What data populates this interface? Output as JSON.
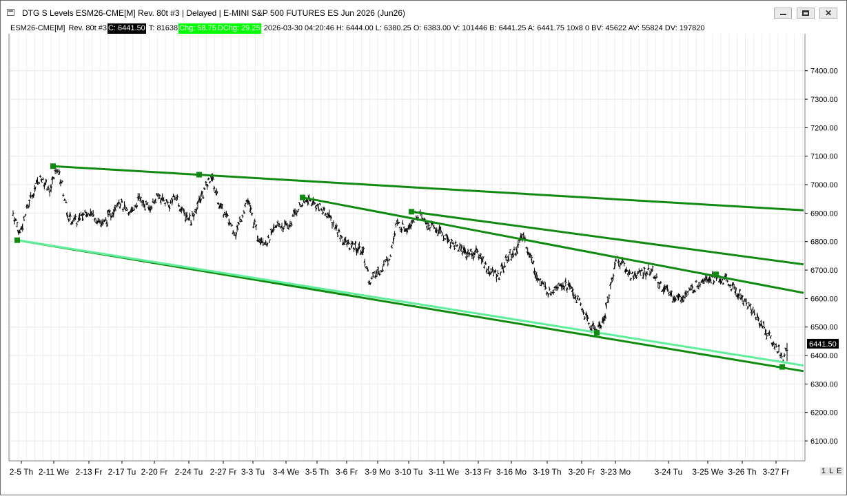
{
  "window": {
    "title": "DTG S Levels ESM26-CME[M]  Rev. 80t #3 | Delayed | E-MINI S&P 500 FUTURES ES Jun 2026 (Jun26)",
    "minimize_icon": "minimize-icon",
    "maximize_icon": "maximize-icon",
    "close_icon": "close-icon",
    "close_glyph": "✕"
  },
  "infobar": {
    "symbol": "ESM26-CME[M]",
    "rev": "Rev. 80t #3",
    "close": "C: 6441.50",
    "ticks": "T: 81638",
    "chg": "Chg: 58.75",
    "dchg": "DChg: 29.25",
    "rest": "2026-03-30 04:20:46 H: 6444.00 L: 6380.25 O: 6383.00 V: 101446 B: 6441.25 A: 6441.75 10x8 0 BV: 45622 AV: 55824 DV: 197820"
  },
  "scroll_label": "1 L E",
  "colors": {
    "trendline": "#118a11",
    "trendline_light": "#5fef9a",
    "bars": "#000000",
    "grid": "#e6e6e6",
    "last_price_bg": "#000000"
  },
  "chart_data": {
    "type": "bar",
    "title": "",
    "ylim": [
      6030,
      7530
    ],
    "y_ticks": [
      7400,
      7300,
      7200,
      7100,
      7000,
      6900,
      6800,
      6700,
      6600,
      6500,
      6400,
      6300,
      6200,
      6100
    ],
    "x_labels": [
      "2-5 Th",
      "2-11 We",
      "2-13 Fr",
      "2-17 Tu",
      "2-20 Fr",
      "2-24 Tu",
      "2-27 Fr",
      "3-3 Tu",
      "3-4 We",
      "3-5 Th",
      "3-6 Fr",
      "3-9 Mo",
      "3-10 Tu",
      "3-11 We",
      "3-13 Fr",
      "3-16 Mo",
      "3-19 Th",
      "3-20 Fr",
      "3-23 Mo",
      "3-24 Tu",
      "3-25 We",
      "3-26 Th",
      "3-27 Fr"
    ],
    "last_price": "6441.50",
    "price_path": [
      [
        0,
        6900
      ],
      [
        10,
        6830
      ],
      [
        25,
        6950
      ],
      [
        40,
        7030
      ],
      [
        55,
        6980
      ],
      [
        64,
        7060
      ],
      [
        72,
        7000
      ],
      [
        82,
        6880
      ],
      [
        95,
        6870
      ],
      [
        108,
        6910
      ],
      [
        120,
        6890
      ],
      [
        132,
        6860
      ],
      [
        145,
        6900
      ],
      [
        155,
        6950
      ],
      [
        170,
        6890
      ],
      [
        185,
        6950
      ],
      [
        200,
        6920
      ],
      [
        215,
        6960
      ],
      [
        230,
        6930
      ],
      [
        240,
        6960
      ],
      [
        250,
        6900
      ],
      [
        262,
        6880
      ],
      [
        278,
        6960
      ],
      [
        292,
        7030
      ],
      [
        305,
        6920
      ],
      [
        316,
        6880
      ],
      [
        328,
        6830
      ],
      [
        345,
        6950
      ],
      [
        360,
        6820
      ],
      [
        375,
        6800
      ],
      [
        390,
        6860
      ],
      [
        405,
        6850
      ],
      [
        420,
        6920
      ],
      [
        435,
        6950
      ],
      [
        450,
        6920
      ],
      [
        462,
        6900
      ],
      [
        475,
        6850
      ],
      [
        488,
        6800
      ],
      [
        500,
        6780
      ],
      [
        515,
        6770
      ],
      [
        525,
        6660
      ],
      [
        540,
        6700
      ],
      [
        555,
        6750
      ],
      [
        565,
        6860
      ],
      [
        580,
        6850
      ],
      [
        595,
        6900
      ],
      [
        610,
        6860
      ],
      [
        625,
        6840
      ],
      [
        640,
        6810
      ],
      [
        655,
        6780
      ],
      [
        670,
        6760
      ],
      [
        685,
        6760
      ],
      [
        700,
        6700
      ],
      [
        715,
        6680
      ],
      [
        728,
        6740
      ],
      [
        740,
        6770
      ],
      [
        752,
        6820
      ],
      [
        763,
        6740
      ],
      [
        775,
        6660
      ],
      [
        790,
        6620
      ],
      [
        805,
        6660
      ],
      [
        820,
        6640
      ],
      [
        835,
        6580
      ],
      [
        848,
        6510
      ],
      [
        858,
        6490
      ],
      [
        870,
        6520
      ],
      [
        880,
        6640
      ],
      [
        888,
        6740
      ],
      [
        898,
        6720
      ],
      [
        910,
        6680
      ],
      [
        925,
        6690
      ],
      [
        940,
        6700
      ],
      [
        952,
        6650
      ],
      [
        965,
        6620
      ],
      [
        980,
        6600
      ],
      [
        995,
        6620
      ],
      [
        1008,
        6650
      ],
      [
        1020,
        6680
      ],
      [
        1035,
        6670
      ],
      [
        1050,
        6660
      ],
      [
        1062,
        6630
      ],
      [
        1075,
        6600
      ],
      [
        1088,
        6560
      ],
      [
        1100,
        6520
      ],
      [
        1110,
        6480
      ],
      [
        1120,
        6440
      ],
      [
        1127,
        6420
      ],
      [
        1134,
        6390
      ],
      [
        1140,
        6420
      ]
    ],
    "trendlines": [
      {
        "from": {
          "bar": "2-11 We",
          "price": 7065
        },
        "to": {
          "bar": "end",
          "price": 6910
        }
      },
      {
        "from": {
          "bar": "3-4 We",
          "price": 6955
        },
        "to": {
          "bar": "end",
          "price": 6620
        }
      },
      {
        "from": {
          "bar": "3-10 Tu",
          "price": 6905
        },
        "to": {
          "bar": "end",
          "price": 6720
        }
      },
      {
        "from": {
          "bar": "2-5 Th",
          "price": 6805
        },
        "to": {
          "bar": "end",
          "price": 6345
        }
      },
      {
        "from": {
          "bar": "2-5 Th",
          "price": 6805
        },
        "to": {
          "bar": "end",
          "price": 6365
        },
        "light": true
      }
    ],
    "anchors": [
      {
        "bar": "2-5 Th",
        "price": 6805
      },
      {
        "bar": "2-11 We",
        "price": 7065
      },
      {
        "bar": "2-24 Tu",
        "price": 7035
      },
      {
        "bar": "3-4 We",
        "price": 6955
      },
      {
        "bar": "3-10 Tu",
        "price": 6905
      },
      {
        "bar": "3-20 Fr",
        "price": 6480
      },
      {
        "bar": "3-25 We",
        "price": 6685
      },
      {
        "bar": "3-27 Fr",
        "price": 6360
      }
    ]
  }
}
